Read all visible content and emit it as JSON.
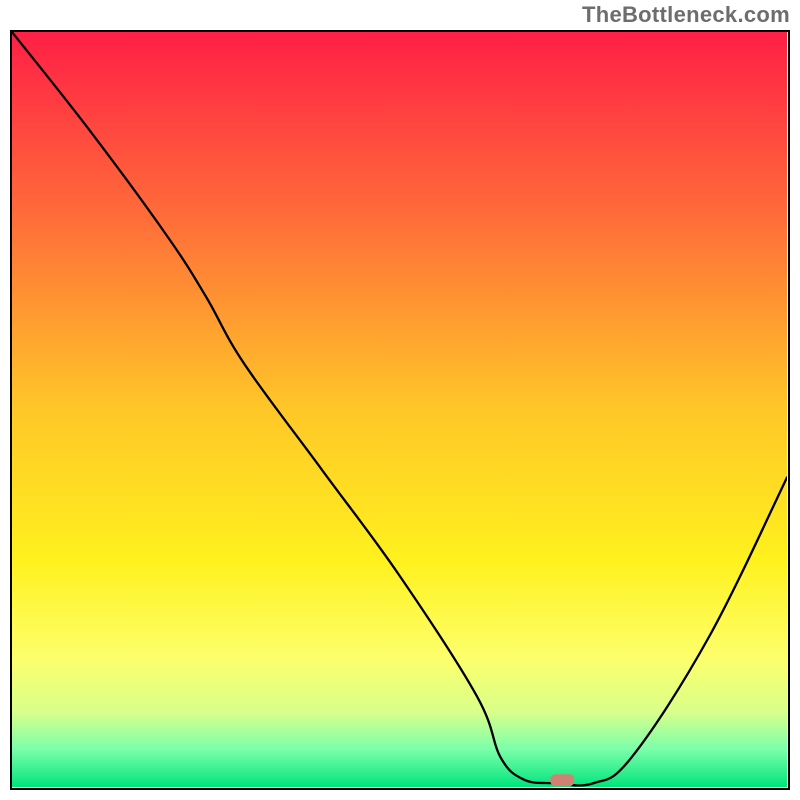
{
  "watermark": "TheBottleneck.com",
  "chart_data": {
    "type": "line",
    "title": "",
    "xlabel": "",
    "ylabel": "",
    "xlim": [
      0,
      100
    ],
    "ylim": [
      0,
      100
    ],
    "grid": false,
    "legend": false,
    "series": [
      {
        "name": "curve",
        "x": [
          0,
          10,
          20,
          25,
          30,
          40,
          50,
          60,
          63,
          66,
          70,
          75,
          80,
          90,
          100
        ],
        "y": [
          100,
          87,
          73,
          65,
          56,
          42,
          28,
          12,
          4,
          1,
          0.5,
          0.5,
          4,
          20,
          41
        ],
        "color": "#000000"
      }
    ],
    "marker": {
      "x": 71,
      "y": 0.5,
      "color": "#cf8273"
    },
    "background_gradient": {
      "stops": [
        {
          "offset": 0.0,
          "color": "#ff1f46"
        },
        {
          "offset": 0.25,
          "color": "#ff6e39"
        },
        {
          "offset": 0.5,
          "color": "#ffc728"
        },
        {
          "offset": 0.7,
          "color": "#fff11e"
        },
        {
          "offset": 0.83,
          "color": "#fdff6c"
        },
        {
          "offset": 0.9,
          "color": "#d9ff8a"
        },
        {
          "offset": 0.95,
          "color": "#7bffaa"
        },
        {
          "offset": 1.0,
          "color": "#00e47c"
        }
      ]
    }
  }
}
